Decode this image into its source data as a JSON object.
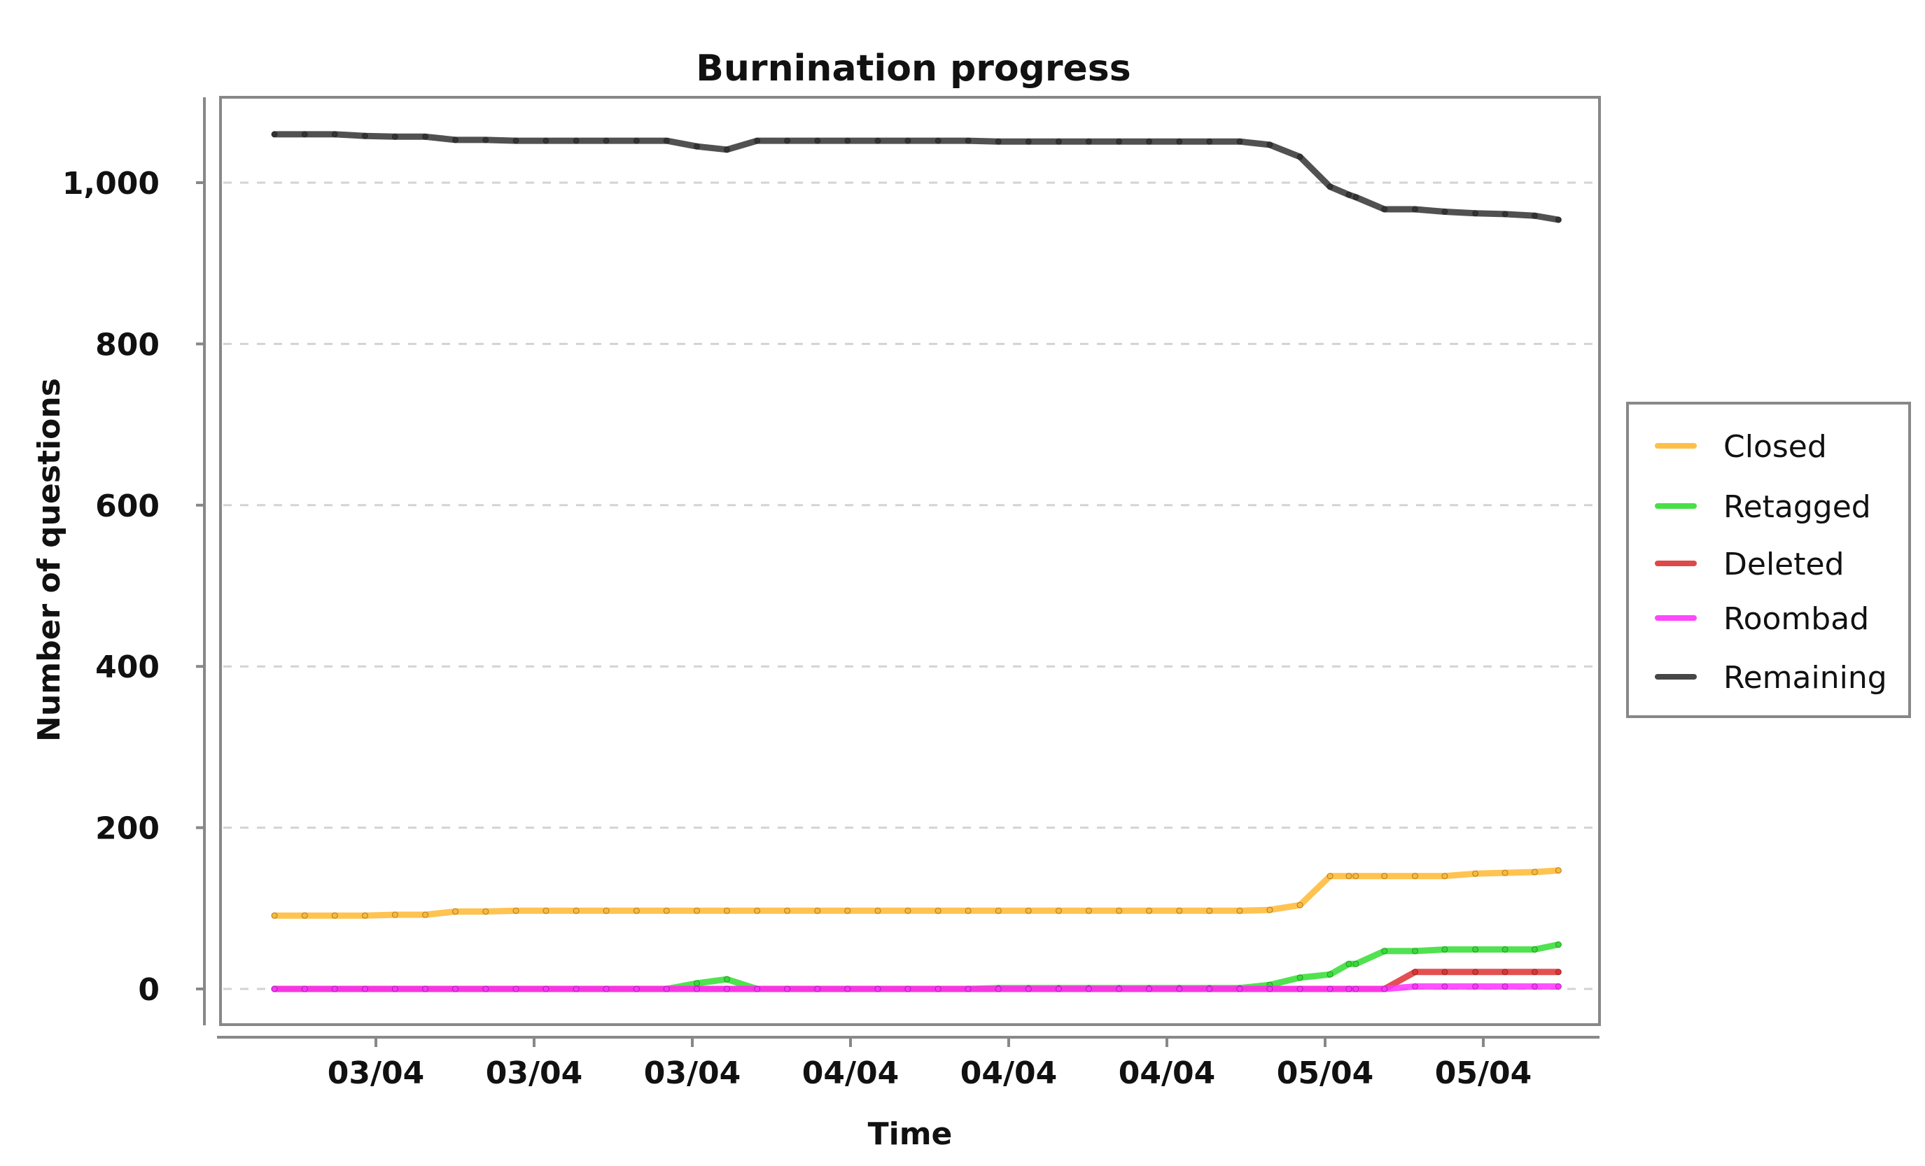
{
  "chart_data": {
    "type": "line",
    "title": "Burnination progress",
    "xlabel": "Time",
    "ylabel": "Number of questions",
    "ylim": [
      -45,
      1100
    ],
    "yticks": [
      0,
      200,
      400,
      600,
      800,
      1000
    ],
    "ytick_labels": [
      "0",
      "200",
      "400",
      "600",
      "800",
      "1,000"
    ],
    "xlim_hours": [
      -8.0,
      61.9
    ],
    "xticks_hours": [
      0,
      8,
      16,
      24,
      32,
      40,
      48,
      56
    ],
    "xtick_labels": [
      "03/04",
      "03/04",
      "03/04",
      "04/04",
      "04/04",
      "04/04",
      "05/04",
      "05/04"
    ],
    "grid": "horizontal-dashed",
    "legend_position": "right",
    "x_hours": [
      -5.13,
      -3.6,
      -2.08,
      -0.55,
      0.97,
      2.5,
      4.02,
      5.55,
      7.08,
      8.6,
      10.13,
      11.65,
      13.18,
      14.7,
      16.23,
      17.75,
      19.28,
      20.8,
      22.33,
      23.85,
      25.38,
      26.9,
      28.43,
      29.95,
      31.48,
      33.0,
      34.53,
      36.05,
      37.58,
      39.1,
      40.63,
      42.15,
      43.68,
      45.2,
      46.73,
      48.25,
      49.2,
      49.55,
      51.0,
      52.55,
      54.05,
      55.6,
      57.1,
      58.6,
      59.8
    ],
    "series": [
      {
        "name": "Closed",
        "color": "#FFB833",
        "values": [
          91,
          91,
          91,
          91,
          92,
          92,
          96,
          96,
          97,
          97,
          97,
          97,
          97,
          97,
          97,
          97,
          97,
          97,
          97,
          97,
          97,
          97,
          97,
          97,
          97,
          97,
          97,
          97,
          97,
          97,
          97,
          97,
          97,
          98,
          104,
          140,
          140,
          140,
          140,
          140,
          140,
          143,
          144,
          145,
          147
        ]
      },
      {
        "name": "Retagged",
        "color": "#33DD33",
        "values": [
          0,
          0,
          0,
          0,
          0,
          0,
          0,
          0,
          0,
          0,
          0,
          0,
          0,
          0,
          7,
          12,
          0,
          0,
          0,
          0,
          0,
          0,
          0,
          0,
          1,
          1,
          1,
          1,
          1,
          1,
          1,
          1,
          1,
          5,
          14,
          18,
          31,
          31,
          47,
          47,
          49,
          49,
          49,
          49,
          55
        ]
      },
      {
        "name": "Deleted",
        "color": "#DD3333",
        "values": [
          0,
          0,
          0,
          0,
          0,
          0,
          0,
          0,
          0,
          0,
          0,
          0,
          0,
          0,
          0,
          0,
          0,
          0,
          0,
          0,
          0,
          0,
          0,
          0,
          0,
          0,
          0,
          0,
          0,
          0,
          0,
          0,
          0,
          0,
          0,
          0,
          0,
          0,
          0,
          21,
          21,
          21,
          21,
          21,
          21
        ]
      },
      {
        "name": "Roombad",
        "color": "#FF33FF",
        "values": [
          0,
          0,
          0,
          0,
          0,
          0,
          0,
          0,
          0,
          0,
          0,
          0,
          0,
          0,
          0,
          0,
          0,
          0,
          0,
          0,
          0,
          0,
          0,
          0,
          0,
          0,
          0,
          0,
          0,
          0,
          0,
          0,
          0,
          0,
          0,
          0,
          0,
          0,
          0,
          3,
          3,
          3,
          3,
          3,
          3
        ]
      },
      {
        "name": "Remaining",
        "color": "#333333",
        "values": [
          1060,
          1060,
          1060,
          1058,
          1057,
          1057,
          1053,
          1053,
          1052,
          1052,
          1052,
          1052,
          1052,
          1052,
          1045,
          1041,
          1052,
          1052,
          1052,
          1052,
          1052,
          1052,
          1052,
          1052,
          1051,
          1051,
          1051,
          1051,
          1051,
          1051,
          1051,
          1051,
          1051,
          1047,
          1032,
          995,
          985,
          982,
          967,
          967,
          964,
          962,
          961,
          959,
          954
        ]
      }
    ]
  }
}
